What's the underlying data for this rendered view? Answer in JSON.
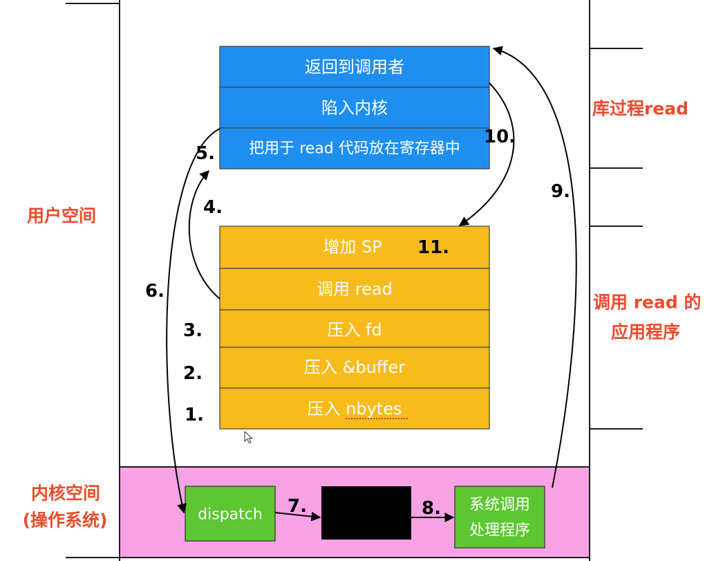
{
  "labels": {
    "user_space": "用户空间",
    "kernel_space": "内核空间",
    "operating_system": "(操作系统)",
    "library_procedure": "库过程read",
    "application_line1": "调用 read 的",
    "application_line2": "应用程序"
  },
  "library_procedure_steps": [
    "返回到调用者",
    "陷入内核",
    "把用于 read 代码放在寄存器中"
  ],
  "application_steps": [
    "增加 SP",
    "调用 read",
    "压入 fd",
    "压入 &buffer",
    "压入 nbytes"
  ],
  "kernel": {
    "dispatch": "dispatch",
    "handler_line1": "系统调用",
    "handler_line2": "处理程序"
  },
  "step_numbers": [
    "1.",
    "2.",
    "3.",
    "4.",
    "5.",
    "6.",
    "7.",
    "8.",
    "9.",
    "10.",
    "11."
  ],
  "colors": {
    "library_block": "#1e8ff0",
    "application_block": "#f7bb1c",
    "kernel_region": "#f7a2e4",
    "kernel_box": "#5cc731",
    "black_box": "#000000",
    "label_red": "#eb4b2d"
  },
  "icons": {
    "cursor": "mouse-cursor-icon"
  }
}
